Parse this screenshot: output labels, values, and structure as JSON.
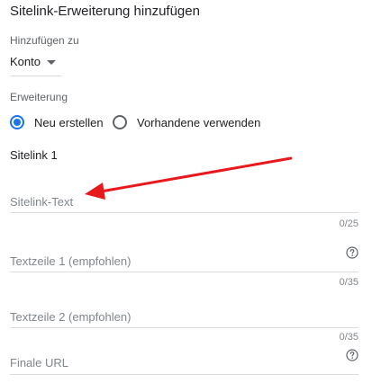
{
  "dialog": {
    "title": "Sitelink-Erweiterung hinzufügen"
  },
  "add_to": {
    "label": "Hinzufügen zu",
    "selected": "Konto"
  },
  "extension": {
    "label": "Erweiterung",
    "options": [
      {
        "label": "Neu erstellen",
        "checked": true
      },
      {
        "label": "Vorhandene verwenden",
        "checked": false
      }
    ]
  },
  "sitelink": {
    "heading": "Sitelink 1",
    "fields": [
      {
        "placeholder": "Sitelink-Text",
        "counter": "0/25",
        "help": false
      },
      {
        "placeholder": "Textzeile 1 (empfohlen)",
        "counter": "0/35",
        "help": true
      },
      {
        "placeholder": "Textzeile 2 (empfohlen)",
        "counter": "0/35",
        "help": false
      },
      {
        "placeholder": "Finale URL",
        "help": true
      }
    ]
  },
  "colors": {
    "accent": "#1a73e8",
    "annotation_arrow": "#e8191c",
    "divider": "#dadce0"
  },
  "icons": {
    "dropdown": "triangle-down-icon",
    "help": "question-mark-circle-icon",
    "annotation": "red-arrow-icon"
  }
}
